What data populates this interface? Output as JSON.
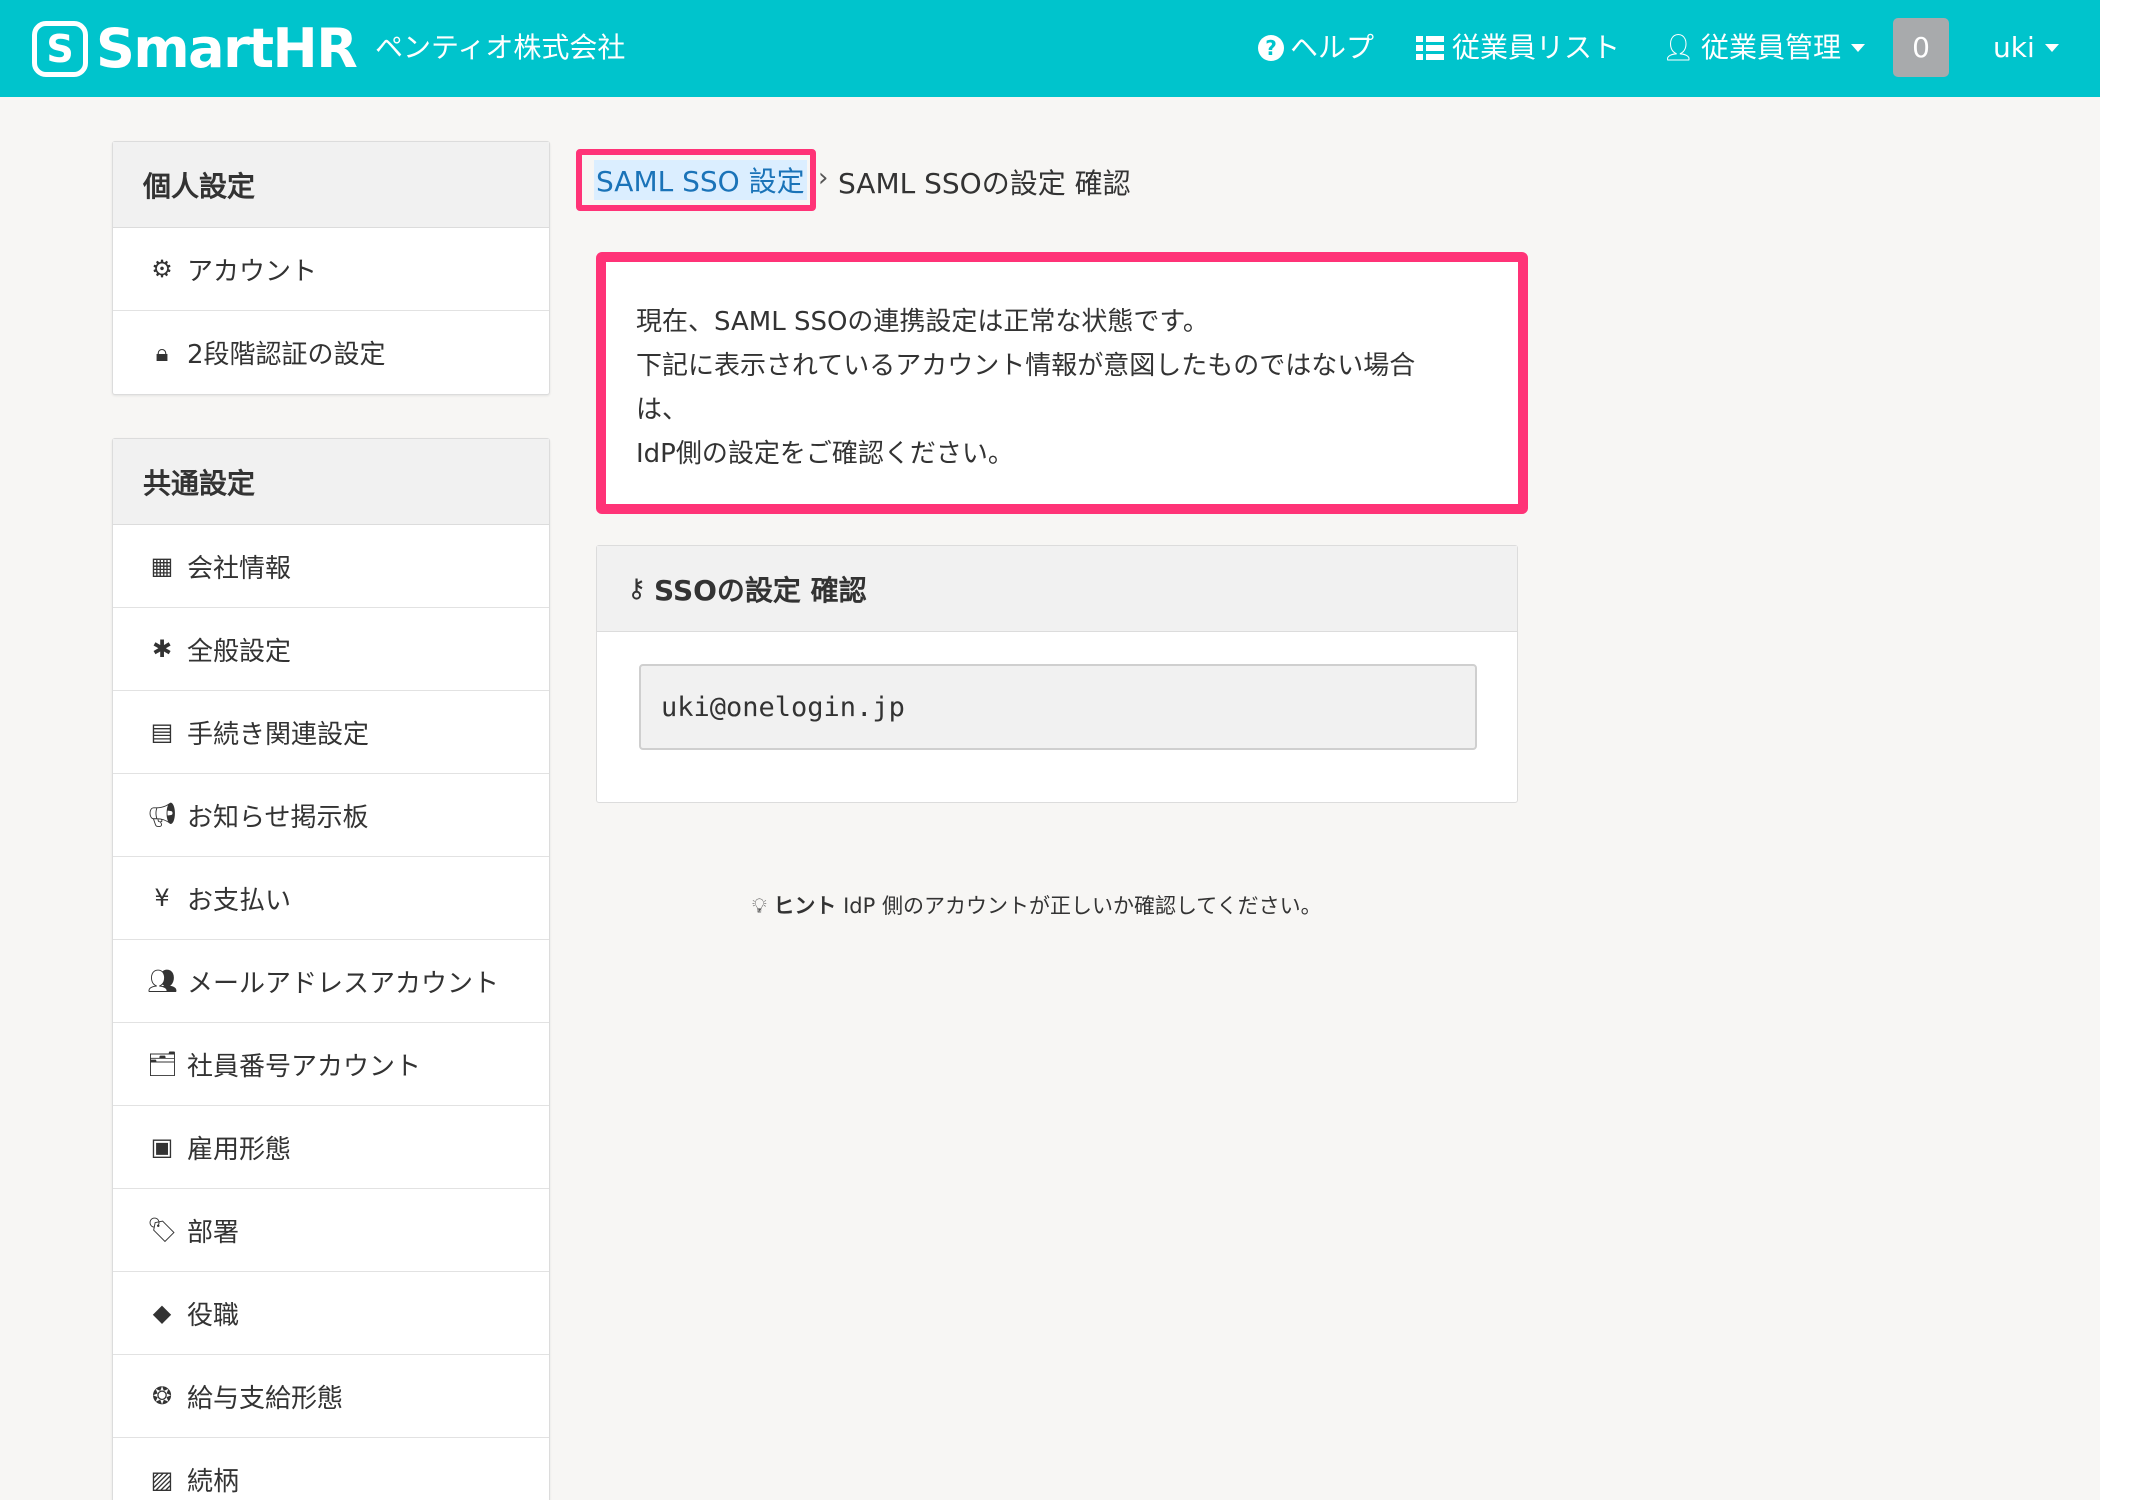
{
  "header": {
    "brand": "SmartHR",
    "brand_mark": "S",
    "company": "ペンティオ株式会社",
    "help_label": "ヘルプ",
    "employee_list_label": "従業員リスト",
    "employee_management_label": "従業員管理",
    "notification_count": "0",
    "user_name": "uki"
  },
  "sidebar": {
    "personal": {
      "heading": "個人設定",
      "items": [
        {
          "label": "アカウント",
          "icon": "gear-icon"
        },
        {
          "label": "2段階認証の設定",
          "icon": "lock-icon"
        }
      ]
    },
    "common": {
      "heading": "共通設定",
      "items": [
        {
          "label": "会社情報",
          "icon": "building-icon"
        },
        {
          "label": "全般設定",
          "icon": "asterisk-icon"
        },
        {
          "label": "手続き関連設定",
          "icon": "book-icon"
        },
        {
          "label": "お知らせ掲示板",
          "icon": "bullhorn-icon"
        },
        {
          "label": "お支払い",
          "icon": "yen-icon"
        },
        {
          "label": "メールアドレスアカウント",
          "icon": "users-icon"
        },
        {
          "label": "社員番号アカウント",
          "icon": "id-card-icon"
        },
        {
          "label": "雇用形態",
          "icon": "badge-icon"
        },
        {
          "label": "部署",
          "icon": "tags-icon"
        },
        {
          "label": "役職",
          "icon": "tag-icon"
        },
        {
          "label": "給与支給形態",
          "icon": "money-icon"
        },
        {
          "label": "続柄",
          "icon": "contact-icon"
        }
      ]
    }
  },
  "breadcrumb": {
    "link": "SAML SSO 設定",
    "separator": "›",
    "current": "SAML SSOの設定 確認"
  },
  "notice": {
    "line1": "現在、SAML SSOの連携設定は正常な状態です。",
    "line2": "下記に表示されているアカウント情報が意図したものではない場合",
    "line3": "は、",
    "line4": "IdP側の設定をご確認ください。"
  },
  "sso": {
    "title": "SSOの設定 確認",
    "account": "uki@onelogin.jp"
  },
  "hint": {
    "label": "ヒント",
    "text": "IdP 側のアカウントが正しいか確認してください。"
  },
  "colors": {
    "brand": "#00c4cc",
    "highlight": "#ff3377",
    "link": "#1a73b8"
  }
}
